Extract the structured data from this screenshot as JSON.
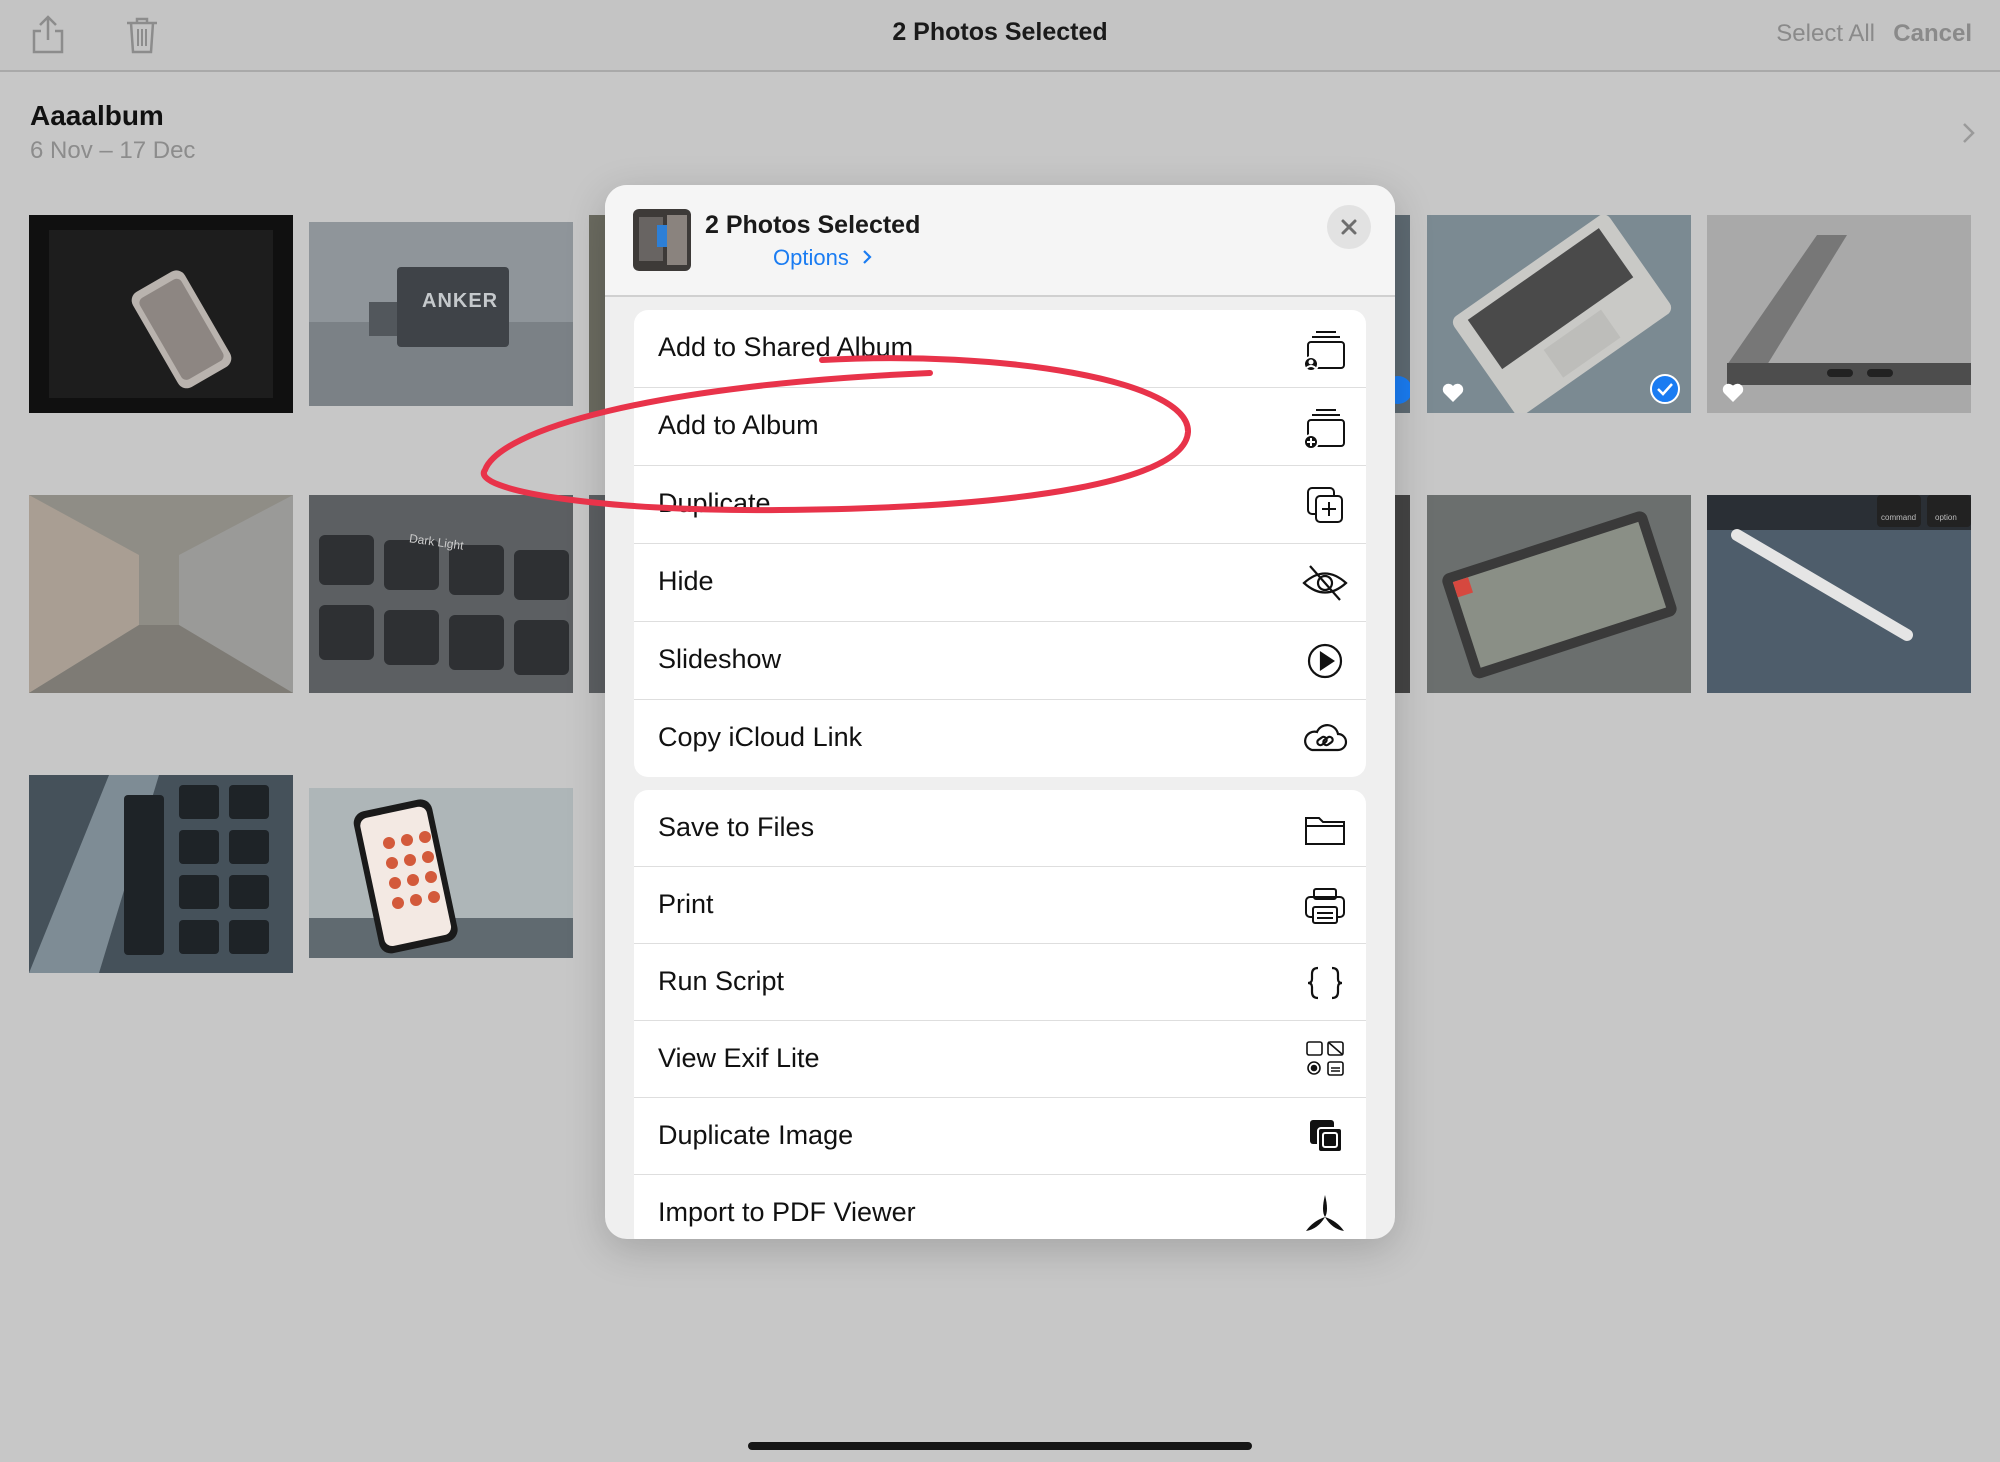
{
  "topbar": {
    "title": "2 Photos Selected",
    "select_all": "Select All",
    "cancel": "Cancel",
    "share_icon": "share-icon",
    "trash_icon": "trash-icon"
  },
  "album": {
    "title": "Aaaalbum",
    "dates": "6 Nov – 17 Dec"
  },
  "thumbnails": {
    "row1": [
      "dark phone photo",
      "ANKER adapter",
      "partial photo",
      "partial photo",
      "laptop top view",
      "laptop side view"
    ],
    "anker_text": "ANKER",
    "keyboard_key_text": "Dark Light",
    "keycap_labels": {
      "command": "command",
      "option": "option"
    }
  },
  "sheet": {
    "title": "2 Photos Selected",
    "options": "Options",
    "group1": [
      {
        "label": "Add to Shared Album",
        "icon": "shared-album-icon"
      },
      {
        "label": "Add to Album",
        "icon": "add-album-icon"
      },
      {
        "label": "Duplicate",
        "icon": "duplicate-icon"
      },
      {
        "label": "Hide",
        "icon": "eye-slash-icon"
      },
      {
        "label": "Slideshow",
        "icon": "play-circle-icon"
      },
      {
        "label": "Copy iCloud Link",
        "icon": "cloud-link-icon"
      }
    ],
    "group2": [
      {
        "label": "Save to Files",
        "icon": "folder-icon"
      },
      {
        "label": "Print",
        "icon": "printer-icon"
      },
      {
        "label": "Run Script",
        "icon": "braces-icon"
      },
      {
        "label": "View Exif Lite",
        "icon": "exif-icon"
      },
      {
        "label": "Duplicate Image",
        "icon": "duplicate-image-icon"
      },
      {
        "label": "Import to PDF Viewer",
        "icon": "pdf-viewer-icon"
      }
    ]
  },
  "colors": {
    "accent": "#1a7cf2",
    "annotation": "#e8334a",
    "dim_background": "#c7c7c7"
  }
}
